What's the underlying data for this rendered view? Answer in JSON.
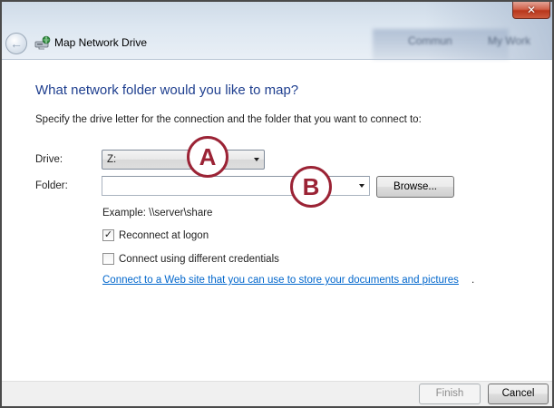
{
  "window": {
    "title": "Map Network Drive",
    "close_glyph": "✕",
    "back_glyph": "←",
    "background_text_1": "Commun",
    "background_text_2": "My Work"
  },
  "content": {
    "heading": "What network folder would you like to map?",
    "instruction": "Specify the drive letter for the connection and the folder that you want to connect to:",
    "drive_label": "Drive:",
    "drive_value": "Z:",
    "folder_label": "Folder:",
    "folder_value": "",
    "browse_label": "Browse...",
    "example_text": "Example: \\\\server\\share",
    "reconnect_label": "Reconnect at logon",
    "reconnect_checked": true,
    "credentials_label": "Connect using different credentials",
    "credentials_checked": false,
    "link_text": "Connect to a Web site that you can use to store your documents and pictures",
    "link_suffix": ".",
    "check_glyph": "✓"
  },
  "callouts": {
    "a": "A",
    "b": "B"
  },
  "footer": {
    "finish_label": "Finish",
    "cancel_label": "Cancel"
  },
  "colors": {
    "heading": "#1f3f8f",
    "link": "#0066cc",
    "callout": "#9b2335",
    "close": "#c9472c"
  },
  "icons": {
    "back": "back-arrow-icon",
    "app": "network-drive-icon",
    "close": "close-icon",
    "drive_dropdown": "chevron-down-icon",
    "folder_dropdown": "chevron-down-icon"
  }
}
